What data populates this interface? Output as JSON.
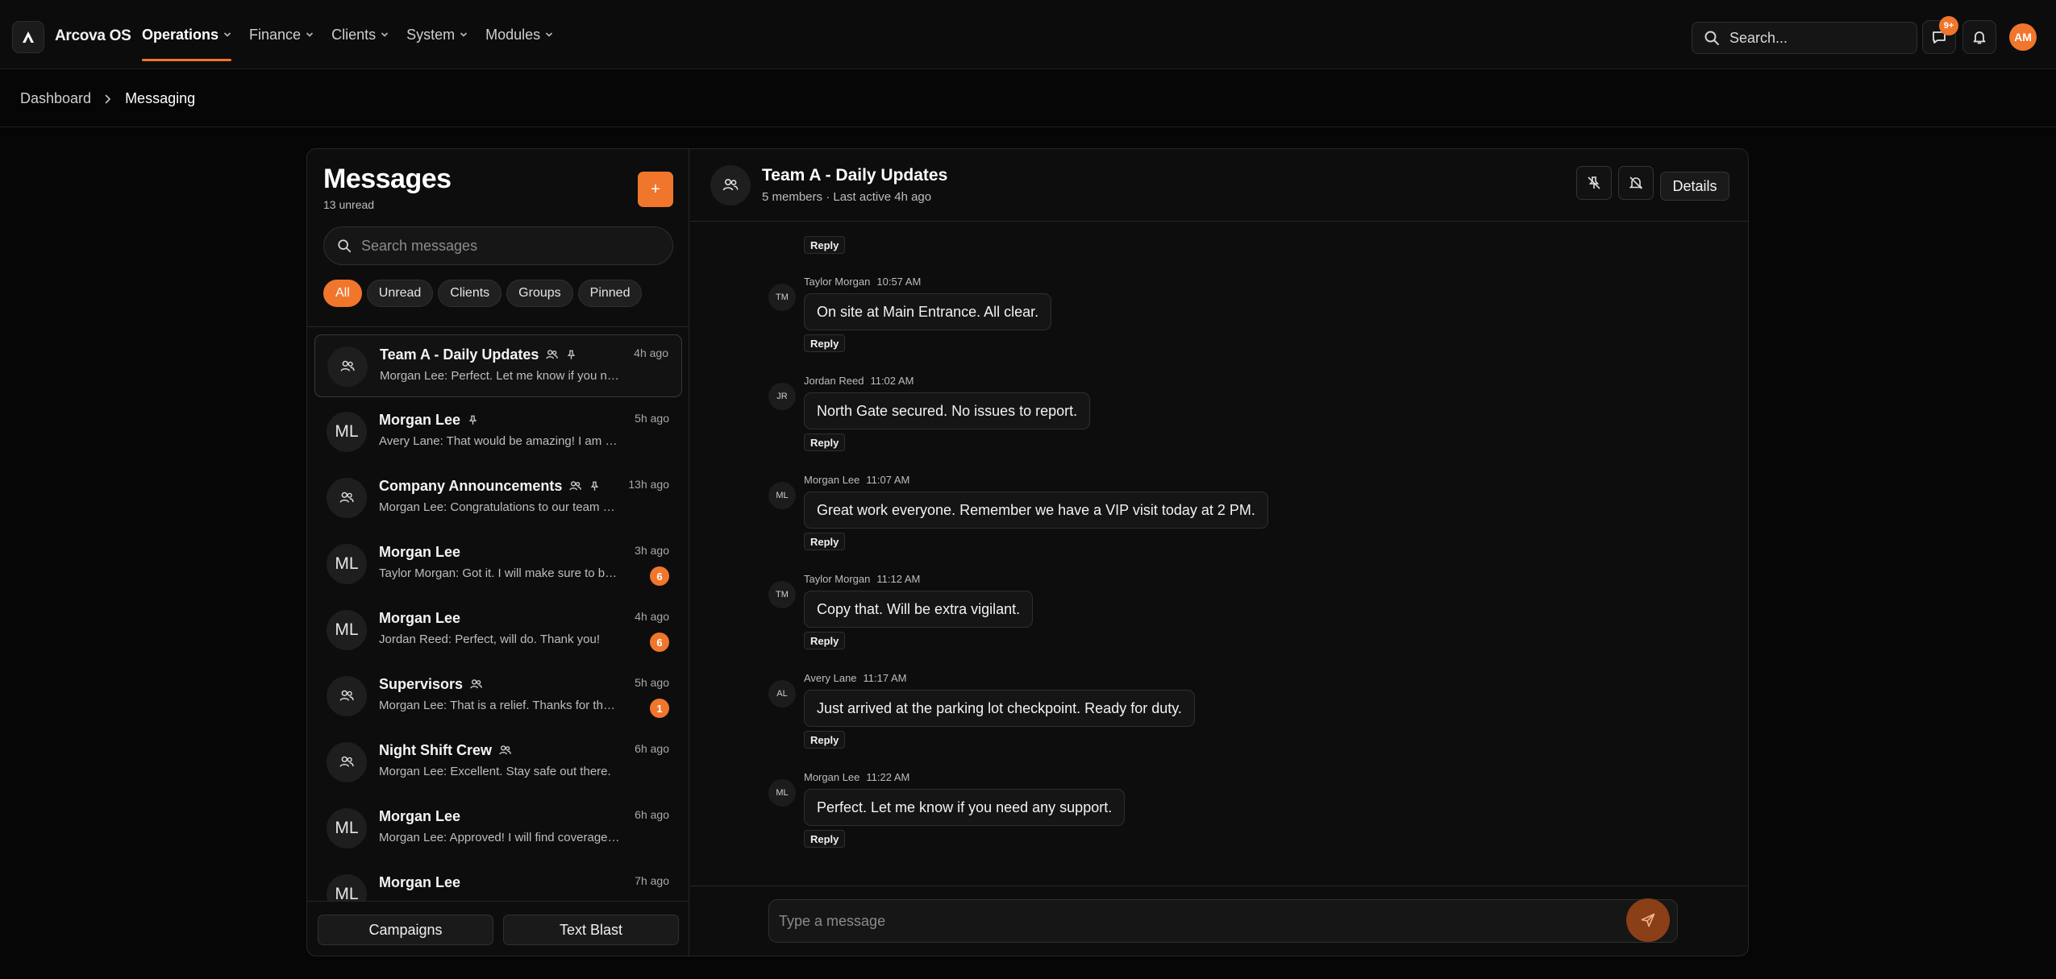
{
  "app": {
    "name": "Arcova OS"
  },
  "nav": [
    {
      "label": "Operations",
      "active": true
    },
    {
      "label": "Finance"
    },
    {
      "label": "Clients"
    },
    {
      "label": "System"
    },
    {
      "label": "Modules"
    }
  ],
  "topbar": {
    "search_placeholder": "Search...",
    "messages_badge": "9+",
    "user_initials": "AM"
  },
  "breadcrumb": {
    "root": "Dashboard",
    "current": "Messaging"
  },
  "sidebar": {
    "title": "Messages",
    "unread": "13 unread",
    "new_label": "+",
    "search_placeholder": "Search messages",
    "filters": [
      "All",
      "Unread",
      "Clients",
      "Groups",
      "Pinned"
    ],
    "conversations": [
      {
        "name": "Team A - Daily Updates",
        "preview": "Morgan Lee: Perfect. Let me know if you need any support.",
        "time": "4h ago",
        "group": true,
        "pinned": true,
        "active": true
      },
      {
        "name": "Morgan Lee",
        "avatar": "ML",
        "preview": "Avery Lane: That would be amazing! I am definitely interested.",
        "time": "5h ago",
        "pinned": true
      },
      {
        "name": "Company Announcements",
        "preview": "Morgan Lee: Congratulations to our team on a great quarter!",
        "time": "13h ago",
        "group": true,
        "pinned": true
      },
      {
        "name": "Morgan Lee",
        "avatar": "ML",
        "preview": "Taylor Morgan: Got it. I will make sure to be there on time.",
        "time": "3h ago",
        "badge": "6"
      },
      {
        "name": "Morgan Lee",
        "avatar": "ML",
        "preview": "Jordan Reed: Perfect, will do. Thank you!",
        "time": "4h ago",
        "badge": "6"
      },
      {
        "name": "Supervisors",
        "preview": "Morgan Lee: That is a relief. Thanks for the update.",
        "time": "5h ago",
        "group": true,
        "badge": "1"
      },
      {
        "name": "Night Shift Crew",
        "preview": "Morgan Lee: Excellent. Stay safe out there.",
        "time": "6h ago",
        "group": true
      },
      {
        "name": "Morgan Lee",
        "avatar": "ML",
        "preview": "Morgan Lee: Approved! I will find coverage for your shift.",
        "time": "6h ago"
      },
      {
        "name": "Morgan Lee",
        "avatar": "ML",
        "preview": "",
        "time": "7h ago"
      }
    ],
    "bottom_buttons": {
      "campaigns": "Campaigns",
      "text_blast": "Text Blast"
    }
  },
  "chat": {
    "title": "Team A - Daily Updates",
    "subtitle": "5 members · Last active 4h ago",
    "details_label": "Details",
    "reply_label": "Reply",
    "messages": [
      {
        "initials": "TM",
        "sender": "Taylor Morgan",
        "time": "10:57 AM",
        "text": "On site at Main Entrance. All clear."
      },
      {
        "initials": "JR",
        "sender": "Jordan Reed",
        "time": "11:02 AM",
        "text": "North Gate secured. No issues to report."
      },
      {
        "initials": "ML",
        "sender": "Morgan Lee",
        "time": "11:07 AM",
        "text": "Great work everyone. Remember we have a VIP visit today at 2 PM."
      },
      {
        "initials": "TM",
        "sender": "Taylor Morgan",
        "time": "11:12 AM",
        "text": "Copy that. Will be extra vigilant."
      },
      {
        "initials": "AL",
        "sender": "Avery Lane",
        "time": "11:17 AM",
        "text": "Just arrived at the parking lot checkpoint. Ready for duty."
      },
      {
        "initials": "ML",
        "sender": "Morgan Lee",
        "time": "11:22 AM",
        "text": "Perfect. Let me know if you need any support."
      }
    ],
    "composer_placeholder": "Type a message"
  },
  "colors": {
    "accent": "#f0762c",
    "background": "#060606",
    "panel": "#0d0d0d"
  }
}
